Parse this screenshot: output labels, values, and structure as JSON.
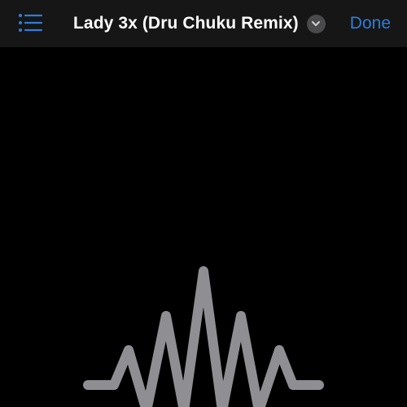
{
  "navbar": {
    "menu_icon": "list-bullet-icon",
    "title": "Lady 3x (Dru Chuku Remix)",
    "title_chevron_icon": "chevron-down-icon",
    "done_label": "Done"
  },
  "visual": {
    "icon": "waveform-icon",
    "stroke_color": "#8e8e93"
  },
  "colors": {
    "background": "#000000",
    "navbar_background": "#161616",
    "accent": "#2f7ddb",
    "title_text": "#ffffff",
    "badge_background": "#4a4a4c"
  }
}
